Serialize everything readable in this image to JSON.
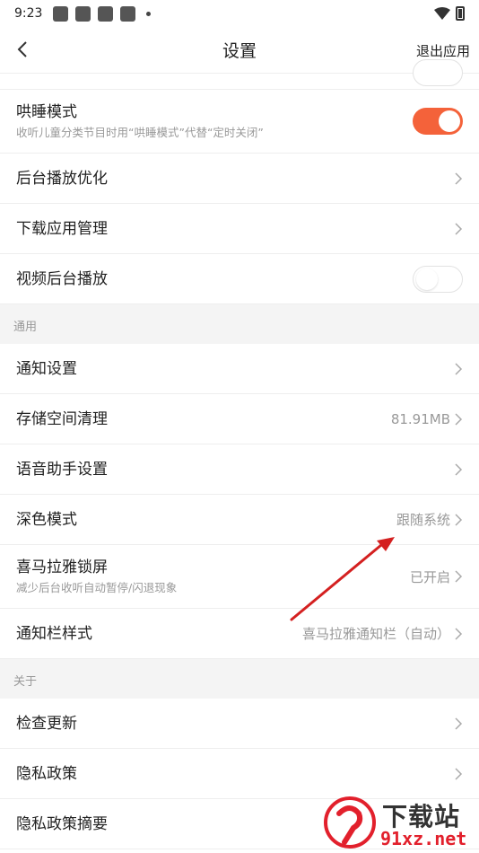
{
  "status_bar": {
    "time": "9:23"
  },
  "nav": {
    "title": "设置",
    "exit_label": "退出应用"
  },
  "rows_top": [
    {
      "label": "哄睡模式",
      "sub": "收听儿童分类节目时用“哄睡模式”代替“定时关闭”",
      "toggle": "on"
    },
    {
      "label": "后台播放优化"
    },
    {
      "label": "下载应用管理"
    },
    {
      "label": "视频后台播放",
      "toggle": "off"
    }
  ],
  "section_general": {
    "title": "通用"
  },
  "rows_general": [
    {
      "label": "通知设置"
    },
    {
      "label": "存储空间清理",
      "value": "81.91MB"
    },
    {
      "label": "语音助手设置"
    },
    {
      "label": "深色模式",
      "value": "跟随系统"
    },
    {
      "label": "喜马拉雅锁屏",
      "sub": "减少后台收听自动暂停/闪退现象",
      "value": "已开启"
    },
    {
      "label": "通知栏样式",
      "value": "喜马拉雅通知栏（自动）"
    }
  ],
  "section_about": {
    "title": "关于"
  },
  "rows_about": [
    {
      "label": "检查更新"
    },
    {
      "label": "隐私政策"
    },
    {
      "label": "隐私政策摘要"
    }
  ],
  "watermark": {
    "title": "下载站",
    "url": "91xz.net"
  },
  "colors": {
    "toggle_on": "#f4623a",
    "arrow": "#d42020"
  }
}
